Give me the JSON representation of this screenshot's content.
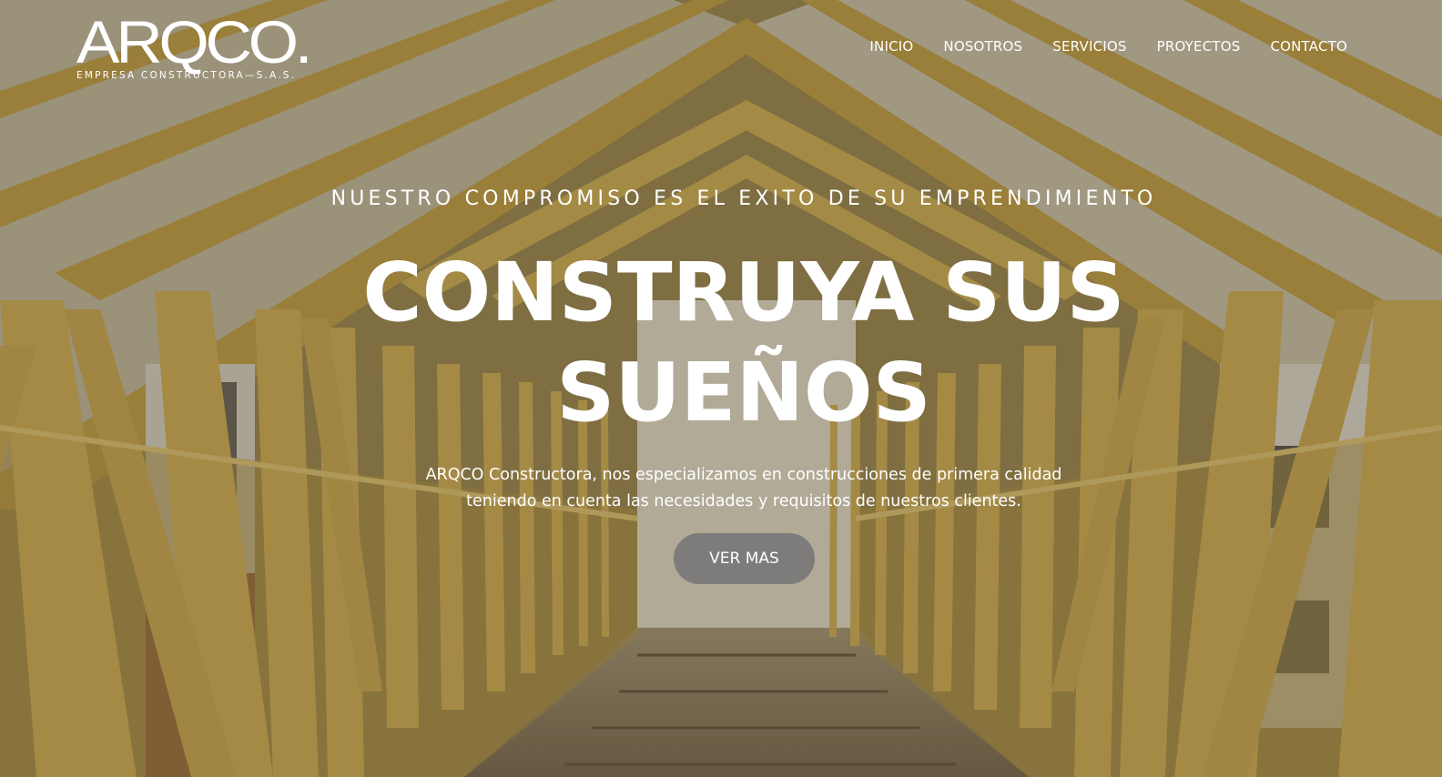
{
  "logo": {
    "wordmark": "ARQCO.",
    "tagline": "EMPRESA CONSTRUCTORA—S.A.S."
  },
  "nav": {
    "items": [
      {
        "label": "INICIO"
      },
      {
        "label": "NOSOTROS"
      },
      {
        "label": "SERVICIOS"
      },
      {
        "label": "PROYECTOS"
      },
      {
        "label": "CONTACTO"
      }
    ]
  },
  "hero": {
    "kicker": "NUESTRO COMPROMISO ES EL EXITO DE SU EMPRENDIMIENTO",
    "headline_line1": "CONSTRUYA SUS",
    "headline_line2": "SUEÑOS",
    "description_line1": "ARQCO Constructora, nos especializamos en construcciones de primera calidad",
    "description_line2": "teniendo en cuenta las necesidades y requisitos de nuestros clientes.",
    "cta_label": "VER MAS"
  },
  "colors": {
    "text": "#ffffff",
    "beam": "#c9a84e",
    "button": "#7a7a7a"
  }
}
